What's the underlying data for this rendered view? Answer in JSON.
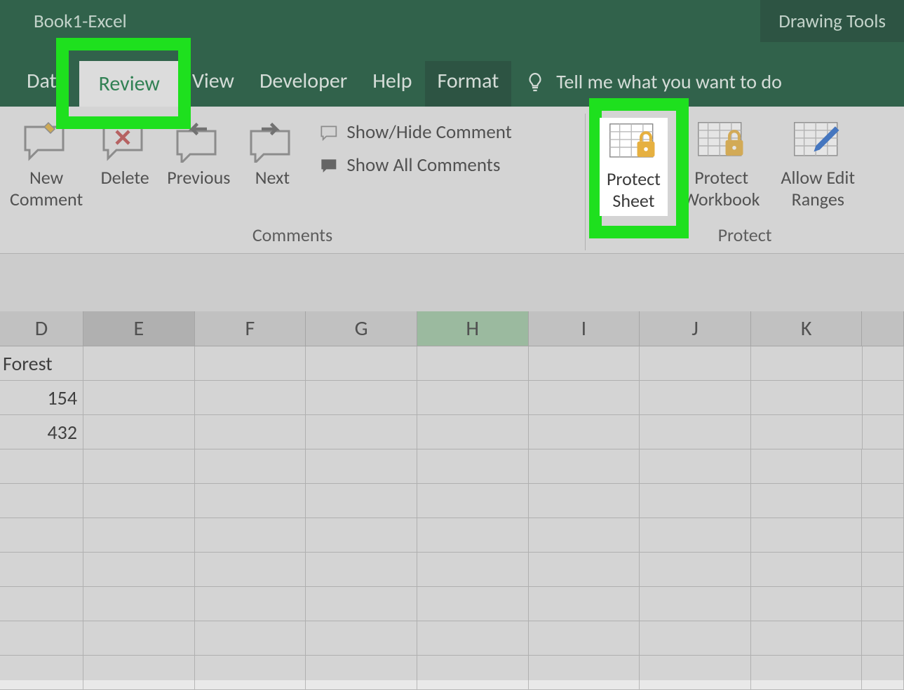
{
  "title": {
    "book": "Book1",
    "sep": "  -  ",
    "app": "Excel",
    "contextual": "Drawing Tools"
  },
  "tabs": {
    "data": "Data",
    "review": "Review",
    "view": "View",
    "developer": "Developer",
    "help": "Help",
    "format": "Format",
    "tellme": "Tell me what you want to do"
  },
  "ribbon": {
    "comments": {
      "group_label": "Comments",
      "new_comment": "New Comment",
      "delete": "Delete",
      "previous": "Previous",
      "next": "Next",
      "show_hide": "Show/Hide Comment",
      "show_all": "Show All Comments"
    },
    "protect": {
      "group_label": "Protect",
      "protect_sheet": "Protect Sheet",
      "protect_workbook": "Protect Workbook",
      "allow_edit": "Allow Edit Ranges"
    }
  },
  "sheet": {
    "columns": [
      "D",
      "E",
      "F",
      "G",
      "H",
      "I",
      "J",
      "K"
    ],
    "selected_col": "E",
    "highlight_col": "H",
    "data": {
      "D1": "Forest",
      "D2": "154",
      "D3": "432"
    },
    "blank_rows": 7
  }
}
